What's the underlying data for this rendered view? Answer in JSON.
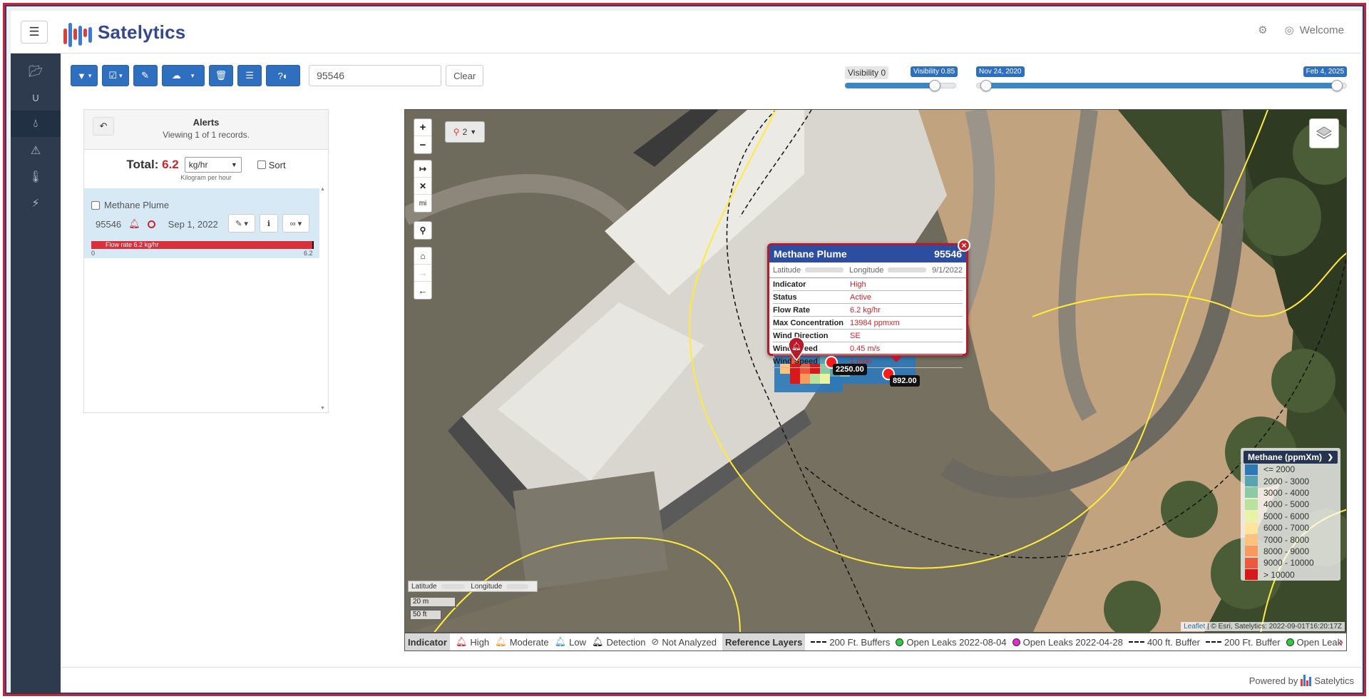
{
  "header": {
    "app_name": "Satelytics",
    "welcome": "Welcome",
    "settings_icon": "users-cog-icon",
    "user_icon": "user-circle-icon"
  },
  "nav": {
    "items": [
      {
        "icon": "folder-open-icon"
      },
      {
        "icon": "magnet-icon"
      },
      {
        "icon": "droplet-icon",
        "active": true
      },
      {
        "icon": "warning-icon"
      },
      {
        "icon": "thermometer-icon"
      },
      {
        "icon": "bolt-icon"
      }
    ]
  },
  "toolbar": {
    "buttons": [
      {
        "icon": "filter-icon"
      },
      {
        "icon": "check-square-icon"
      },
      {
        "icon": "eraser-icon"
      },
      {
        "icon": "cloud-upload-icon"
      },
      {
        "icon": "trash-icon"
      },
      {
        "icon": "list-icon"
      },
      {
        "icon": "help-toggle-icon"
      }
    ],
    "search_value": "95546",
    "clear_label": "Clear"
  },
  "visibility": {
    "min_label": "Visibility 0",
    "value_label": "Visibility 0.85",
    "value": 0.85
  },
  "dates": {
    "start_label": "Nov 24, 2020",
    "end_label": "Feb 4, 2025"
  },
  "alerts": {
    "title": "Alerts",
    "subtitle": "Viewing 1 of 1 records.",
    "total_label": "Total:",
    "total_value": "6.2",
    "unit": "kg/hr",
    "unit_caption": "Kilogram per hour",
    "sort_label": "Sort",
    "item": {
      "name": "Methane Plume",
      "id": "95546",
      "date": "Sep 1, 2022",
      "flow_label": "Flow rate 6.2 kg/hr",
      "flow_min": "0",
      "flow_max": "6.2",
      "flow_fraction": 1.0
    }
  },
  "map": {
    "marker_count": "2",
    "distance_unit": "mi",
    "popup": {
      "title": "Methane Plume",
      "id": "95546",
      "latitude_label": "Latitude",
      "longitude_label": "Longitude",
      "date": "9/1/2022",
      "rows": [
        {
          "k": "Indicator",
          "v": "High"
        },
        {
          "k": "Status",
          "v": "Active"
        },
        {
          "k": "Flow Rate",
          "v": "6.2 kg/hr"
        },
        {
          "k": "Max Concentration",
          "v": "13984 ppmxm"
        },
        {
          "k": "Wind Direction",
          "v": "SE"
        },
        {
          "k": "Wind Speed",
          "v": "0.45 m/s"
        },
        {
          "k": "Wind Speed",
          "v": "1 mph"
        }
      ]
    },
    "tags": [
      "2250.00",
      "892.00"
    ],
    "legend": {
      "title": "Methane (ppmXm)",
      "rows": [
        {
          "label": "<= 2000",
          "color": "#2e78b7"
        },
        {
          "label": "2000 - 3000",
          "color": "#5aa3b0"
        },
        {
          "label": "3000 - 4000",
          "color": "#8ccaa4"
        },
        {
          "label": "4000 - 5000",
          "color": "#b9e29d"
        },
        {
          "label": "5000 - 6000",
          "color": "#e6f4a3"
        },
        {
          "label": "6000 - 7000",
          "color": "#fde69a"
        },
        {
          "label": "7000 - 8000",
          "color": "#fdc27b"
        },
        {
          "label": "8000 - 9000",
          "color": "#f99a5c"
        },
        {
          "label": "9000 - 10000",
          "color": "#ea5a3f"
        },
        {
          "label": "> 10000",
          "color": "#d7191c"
        }
      ]
    },
    "coord_lat": "Latitude",
    "coord_lon": "Longitude",
    "scale_m": "20 m",
    "scale_ft": "50 ft",
    "attribution_leaflet": "Leaflet",
    "attribution_rest": "| © Esri, Satelytics:",
    "attribution_date": "2022-09-01T16:20:17Z"
  },
  "indicator_bar": {
    "indicator_label": "Indicator",
    "items": [
      {
        "label": "High",
        "color": "#c8262f"
      },
      {
        "label": "Moderate",
        "color": "#f0922b"
      },
      {
        "label": "Low",
        "color": "#3a8fd0"
      },
      {
        "label": "Detection",
        "color": "#111111"
      },
      {
        "label": "Not Analyzed",
        "color": "#555555"
      }
    ],
    "ref_label": "Reference Layers",
    "refs": [
      {
        "label": "200 Ft. Buffers",
        "kind": "dash"
      },
      {
        "label": "Open Leaks 2022-08-04",
        "kind": "dot",
        "color": "#2ecc40"
      },
      {
        "label": "Open Leaks 2022-04-28",
        "kind": "dot",
        "color": "#e02ccf"
      },
      {
        "label": "400 ft. Buffer",
        "kind": "dash"
      },
      {
        "label": "200 Ft. Buffer",
        "kind": "dash"
      },
      {
        "label": "Open Leak",
        "kind": "dot",
        "color": "#2ecc40"
      }
    ]
  },
  "footer": {
    "powered_by": "Powered by",
    "brand": "Satelytics"
  }
}
